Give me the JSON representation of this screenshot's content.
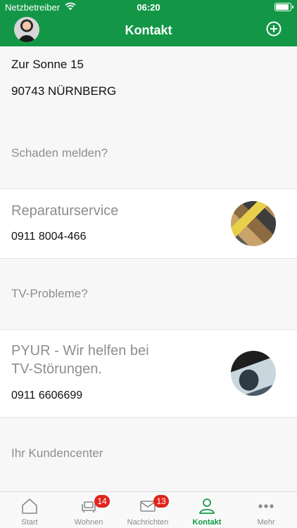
{
  "status_bar": {
    "carrier": "Netzbetreiber",
    "time": "06:20"
  },
  "nav": {
    "title": "Kontakt"
  },
  "address": {
    "street": "Zur Sonne 15",
    "city": "90743 NÜRNBERG"
  },
  "sections": {
    "damage_label": "Schaden melden?",
    "tv_label": "TV-Probleme?",
    "customer_center_label": "Ihr Kundencenter"
  },
  "repair": {
    "title": "Reparaturservice",
    "phone": "0911 8004-466"
  },
  "pyur": {
    "title_line1": "PYUR - Wir helfen bei",
    "title_line2": "TV-Störungen.",
    "phone": "0911 6606699"
  },
  "tabs": [
    {
      "label": "Start",
      "icon": "home-icon"
    },
    {
      "label": "Wohnen",
      "icon": "sofa-icon",
      "badge": "14"
    },
    {
      "label": "Nachrichten",
      "icon": "mail-icon",
      "badge": "13"
    },
    {
      "label": "Kontakt",
      "icon": "person-icon",
      "active": true
    },
    {
      "label": "Mehr",
      "icon": "more-icon"
    }
  ],
  "colors": {
    "brand_green": "#139747",
    "badge_red": "#e0241b"
  }
}
